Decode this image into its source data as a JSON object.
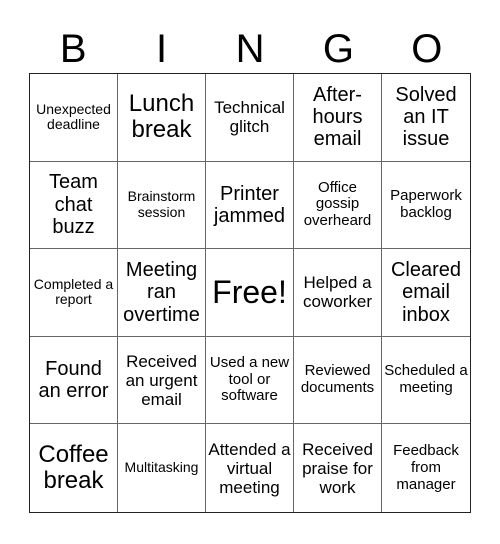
{
  "header": {
    "letters": [
      "B",
      "I",
      "N",
      "G",
      "O"
    ]
  },
  "cells": [
    [
      "Unexpected deadline",
      "Lunch break",
      "Technical glitch",
      "After-hours email",
      "Solved an IT issue"
    ],
    [
      "Team chat buzz",
      "Brainstorm session",
      "Printer jammed",
      "Office gossip overheard",
      "Paperwork backlog"
    ],
    [
      "Completed a report",
      "Meeting ran overtime",
      "Free!",
      "Helped a coworker",
      "Cleared email inbox"
    ],
    [
      "Found an error",
      "Received an urgent email",
      "Used a new tool or software",
      "Reviewed documents",
      "Scheduled a meeting"
    ],
    [
      "Coffee break",
      "Multitasking",
      "Attended a virtual meeting",
      "Received praise for work",
      "Feedback from manager"
    ]
  ]
}
